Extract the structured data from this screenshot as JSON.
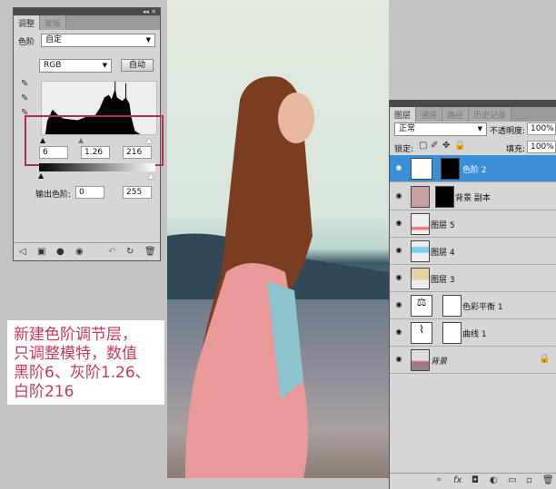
{
  "adjustments": {
    "tabs": [
      "调整",
      "蒙版"
    ],
    "type_label": "色阶",
    "preset": "自定",
    "channel": "RGB",
    "auto_label": "自动",
    "input_black": "6",
    "input_gamma": "1.26",
    "input_white": "216",
    "output_label": "输出色阶:",
    "output_black": "0",
    "output_white": "255"
  },
  "layers": {
    "tabs": [
      "图层",
      "通道",
      "路径",
      "历史记录"
    ],
    "blend_mode": "正常",
    "opacity_label": "不透明度:",
    "opacity": "100%",
    "lock_label": "锁定:",
    "fill_label": "填充:",
    "fill": "100%",
    "items": [
      {
        "name": "色阶 2",
        "selected": true
      },
      {
        "name": "背景 副本"
      },
      {
        "name": "图层 5"
      },
      {
        "name": "图层 4"
      },
      {
        "name": "图层 3"
      },
      {
        "name": "色彩平衡 1"
      },
      {
        "name": "曲线 1"
      },
      {
        "name": "背景"
      }
    ]
  },
  "caption": {
    "lines": [
      "新建色阶调节层，",
      "只调整模特，数值",
      "黑阶6、灰阶1.26、",
      "白阶216"
    ]
  }
}
